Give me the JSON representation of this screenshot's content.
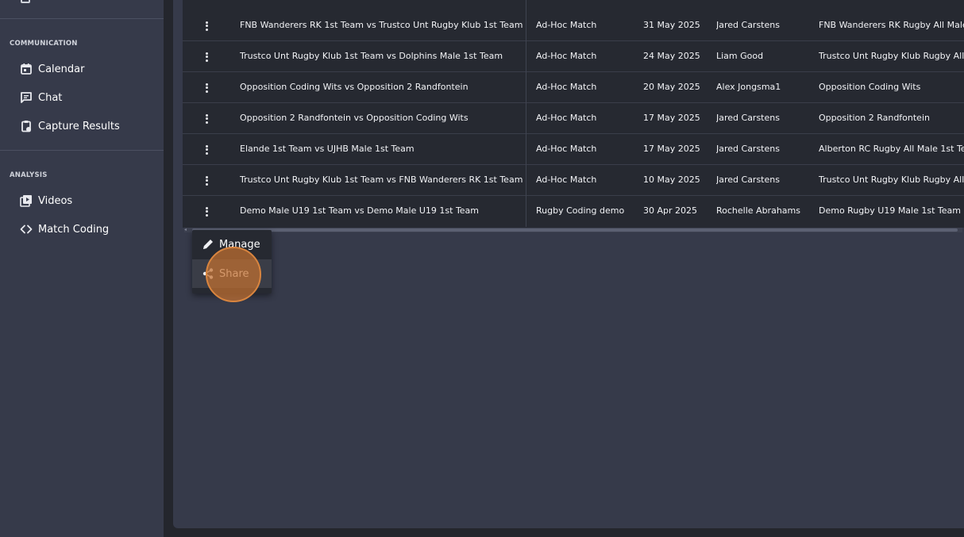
{
  "sidebar": {
    "communication_title": "COMMUNICATION",
    "communication_items": [
      {
        "label": "Calendar",
        "icon": "calendar-icon"
      },
      {
        "label": "Chat",
        "icon": "chat-icon"
      },
      {
        "label": "Capture Results",
        "icon": "clipboard-icon"
      }
    ],
    "analysis_title": "ANALYSIS",
    "analysis_items": [
      {
        "label": "Videos",
        "icon": "video-icon"
      },
      {
        "label": "Match Coding",
        "icon": "code-icon"
      }
    ]
  },
  "table": {
    "rows": [
      {
        "match": "FNB Wanderers RK 1st Team vs Trustco Unt Rugby Klub 1st Team",
        "type": "Ad-Hoc Match",
        "date": "31 May 2025",
        "coder": "Jared Carstens",
        "team": "FNB Wanderers RK Rugby All Male"
      },
      {
        "match": "Trustco Unt Rugby Klub 1st Team vs Dolphins Male 1st Team",
        "type": "Ad-Hoc Match",
        "date": "24 May 2025",
        "coder": "Liam Good",
        "team": "Trustco Unt Rugby Klub Rugby All"
      },
      {
        "match": "Opposition Coding Wits vs Opposition 2 Randfontein",
        "type": "Ad-Hoc Match",
        "date": "20 May 2025",
        "coder": "Alex Jongsma1",
        "team": "Opposition Coding Wits"
      },
      {
        "match": "Opposition 2 Randfontein vs Opposition Coding Wits",
        "type": "Ad-Hoc Match",
        "date": "17 May 2025",
        "coder": "Jared Carstens",
        "team": "Opposition 2 Randfontein"
      },
      {
        "match": "Elande 1st Team vs UJHB Male 1st Team",
        "type": "Ad-Hoc Match",
        "date": "17 May 2025",
        "coder": "Jared Carstens",
        "team": "Alberton RC Rugby All Male 1st Te"
      },
      {
        "match": "Trustco Unt Rugby Klub 1st Team vs FNB Wanderers RK 1st Team",
        "type": "Ad-Hoc Match",
        "date": "10 May 2025",
        "coder": "Jared Carstens",
        "team": "Trustco Unt Rugby Klub Rugby All"
      },
      {
        "match": "Demo Male U19 1st Team vs Demo Male U19 1st Team",
        "type": "Rugby Coding demo",
        "date": "30 Apr 2025",
        "coder": "Rochelle Abrahams",
        "team": "Demo Rugby U19 Male 1st Team"
      }
    ]
  },
  "context_menu": {
    "manage_label": "Manage",
    "share_label": "Share"
  },
  "colors": {
    "sidebar_bg": "#363a4a",
    "table_bg": "#262931",
    "highlight": "#d9853f"
  }
}
